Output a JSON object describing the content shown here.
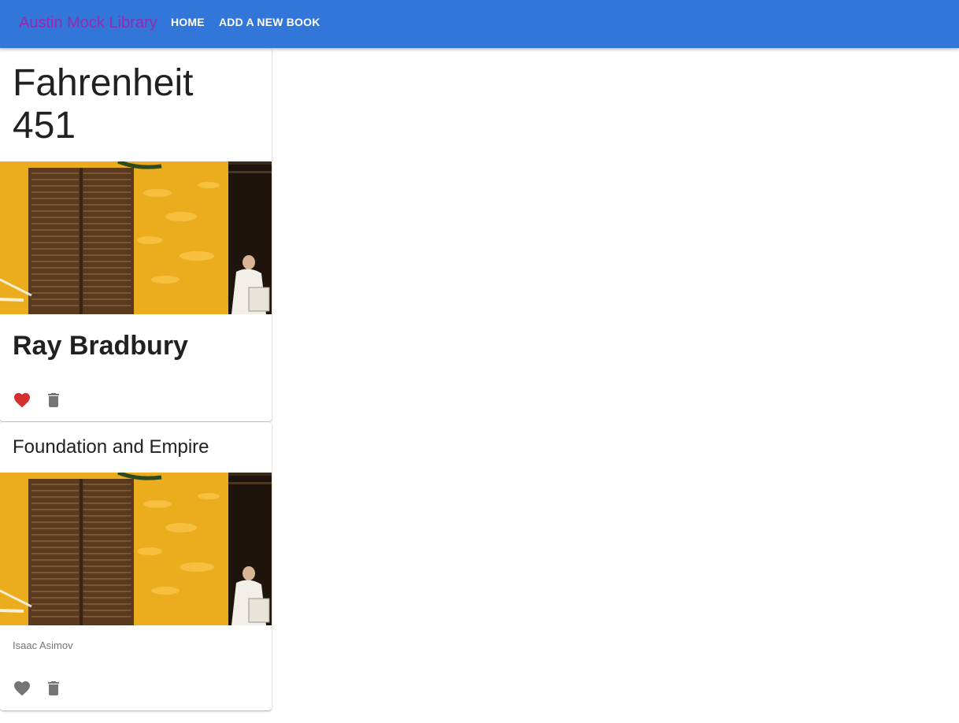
{
  "appbar": {
    "brand": "Austin Mock Library",
    "nav": [
      {
        "label": "HOME"
      },
      {
        "label": "ADD A NEW BOOK"
      }
    ],
    "color": "#3176d8",
    "brand_color": "#9c27b0"
  },
  "books": [
    {
      "title": "Fahrenheit 451",
      "author": "Ray Bradbury",
      "favorited": true,
      "favorite_icon": "heart-icon",
      "delete_icon": "trash-icon",
      "favorite_color": "#d32f2f"
    },
    {
      "title": "Foundation and Empire",
      "author": "Isaac Asimov",
      "favorited": false,
      "favorite_icon": "heart-icon",
      "delete_icon": "trash-icon",
      "favorite_color": "#757575"
    }
  ]
}
